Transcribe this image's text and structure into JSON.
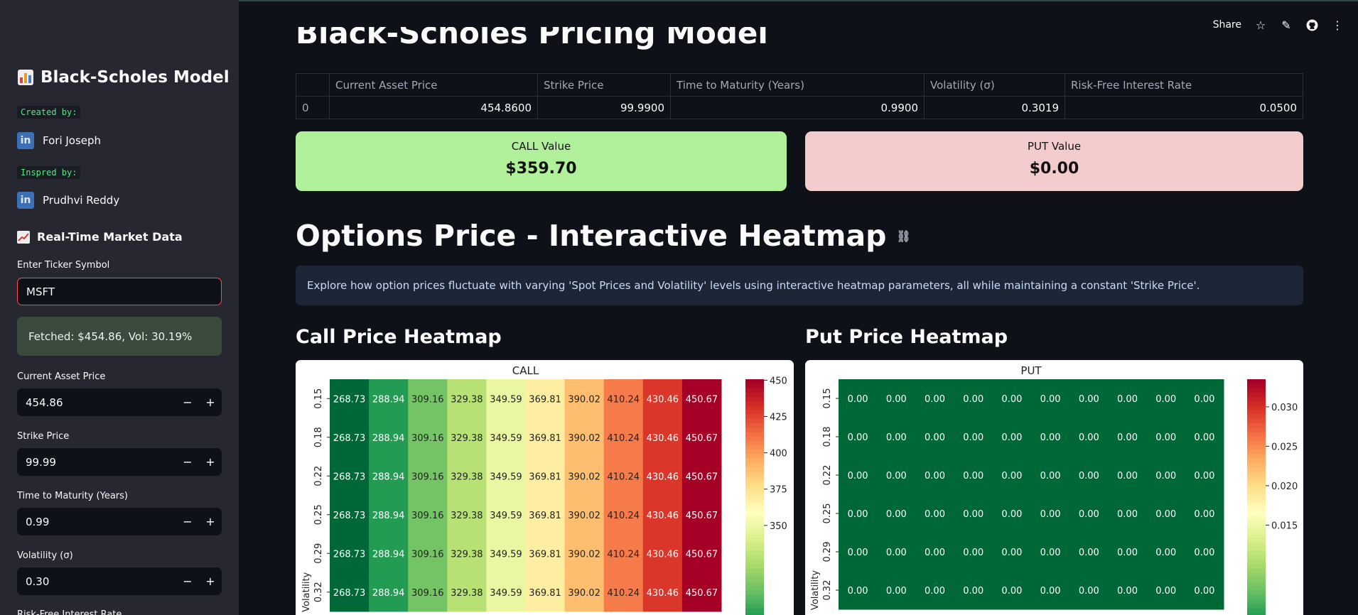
{
  "sidebar": {
    "title": "Black-Scholes Model",
    "created_by_label": "Created by:",
    "author": "Fori Joseph",
    "inspired_by_label": "Inspred by:",
    "inspirer": "Prudhvi Reddy",
    "market_section": "Real-Time Market Data",
    "ticker_label": "Enter Ticker Symbol",
    "ticker_value": "MSFT",
    "fetched_text": "Fetched: $454.86, Vol: 30.19%",
    "inputs": [
      {
        "label": "Current Asset Price",
        "value": "454.86"
      },
      {
        "label": "Strike Price",
        "value": "99.99"
      },
      {
        "label": "Time to Maturity (Years)",
        "value": "0.99"
      },
      {
        "label": "Volatility (σ)",
        "value": "0.30"
      }
    ],
    "cutoff_label": "Risk-Free Interest Rate",
    "minus": "−",
    "plus": "+"
  },
  "toolbar": {
    "share": "Share"
  },
  "main": {
    "title": "Black-Scholes Pricing Model",
    "table": {
      "headers": [
        "",
        "Current Asset Price",
        "Strike Price",
        "Time to Maturity (Years)",
        "Volatility (σ)",
        "Risk-Free Interest Rate"
      ],
      "row": [
        "0",
        "454.8600",
        "99.9900",
        "0.9900",
        "0.3019",
        "0.0500"
      ]
    },
    "call_metric": {
      "label": "CALL Value",
      "value": "$359.70",
      "color": "#b1f09a"
    },
    "put_metric": {
      "label": "PUT Value",
      "value": "$0.00",
      "color": "#f2cccc"
    },
    "heatmap_heading": "Options Price - Interactive Heatmap",
    "info_text": "Explore how option prices fluctuate with varying 'Spot Prices and Volatility' levels using interactive heatmap parameters, all while maintaining a constant 'Strike Price'.",
    "call_heading": "Call Price Heatmap",
    "put_heading": "Put Price Heatmap"
  },
  "chart_data": [
    {
      "type": "heatmap",
      "title": "CALL",
      "ylabel": "Volatility",
      "y_ticks": [
        "0.15",
        "0.18",
        "0.22",
        "0.25",
        "0.29",
        "0.32"
      ],
      "values": [
        [
          268.73,
          288.94,
          309.16,
          329.38,
          349.59,
          369.81,
          390.02,
          410.24,
          430.46,
          450.67
        ],
        [
          268.73,
          288.94,
          309.16,
          329.38,
          349.59,
          369.81,
          390.02,
          410.24,
          430.46,
          450.67
        ],
        [
          268.73,
          288.94,
          309.16,
          329.38,
          349.59,
          369.81,
          390.02,
          410.24,
          430.46,
          450.67
        ],
        [
          268.73,
          288.94,
          309.16,
          329.38,
          349.59,
          369.81,
          390.02,
          410.24,
          430.46,
          450.67
        ],
        [
          268.73,
          288.94,
          309.16,
          329.38,
          349.59,
          369.81,
          390.02,
          410.24,
          430.46,
          450.67
        ],
        [
          268.73,
          288.94,
          309.16,
          329.38,
          349.59,
          369.81,
          390.02,
          410.24,
          430.46,
          450.67
        ]
      ],
      "colorbar_ticks": [
        "450",
        "425",
        "400",
        "375",
        "350"
      ],
      "colorbar_range": [
        268.73,
        450.67
      ],
      "colormap": "RdYlGn_r"
    },
    {
      "type": "heatmap",
      "title": "PUT",
      "ylabel": "Volatility",
      "y_ticks": [
        "0.15",
        "0.18",
        "0.22",
        "0.25",
        "0.29",
        "0.32"
      ],
      "values": [
        [
          0.0,
          0.0,
          0.0,
          0.0,
          0.0,
          0.0,
          0.0,
          0.0,
          0.0,
          0.0
        ],
        [
          0.0,
          0.0,
          0.0,
          0.0,
          0.0,
          0.0,
          0.0,
          0.0,
          0.0,
          0.0
        ],
        [
          0.0,
          0.0,
          0.0,
          0.0,
          0.0,
          0.0,
          0.0,
          0.0,
          0.0,
          0.0
        ],
        [
          0.0,
          0.0,
          0.0,
          0.0,
          0.0,
          0.0,
          0.0,
          0.0,
          0.0,
          0.0
        ],
        [
          0.0,
          0.0,
          0.0,
          0.0,
          0.0,
          0.0,
          0.0,
          0.0,
          0.0,
          0.0
        ],
        [
          0.0,
          0.0,
          0.0,
          0.0,
          0.0,
          0.0,
          0.0,
          0.0,
          0.0,
          0.0
        ]
      ],
      "colorbar_ticks": [
        "0.030",
        "0.025",
        "0.020",
        "0.015"
      ],
      "colorbar_range": [
        0.0,
        0.0335
      ],
      "colormap": "RdYlGn_r"
    }
  ]
}
